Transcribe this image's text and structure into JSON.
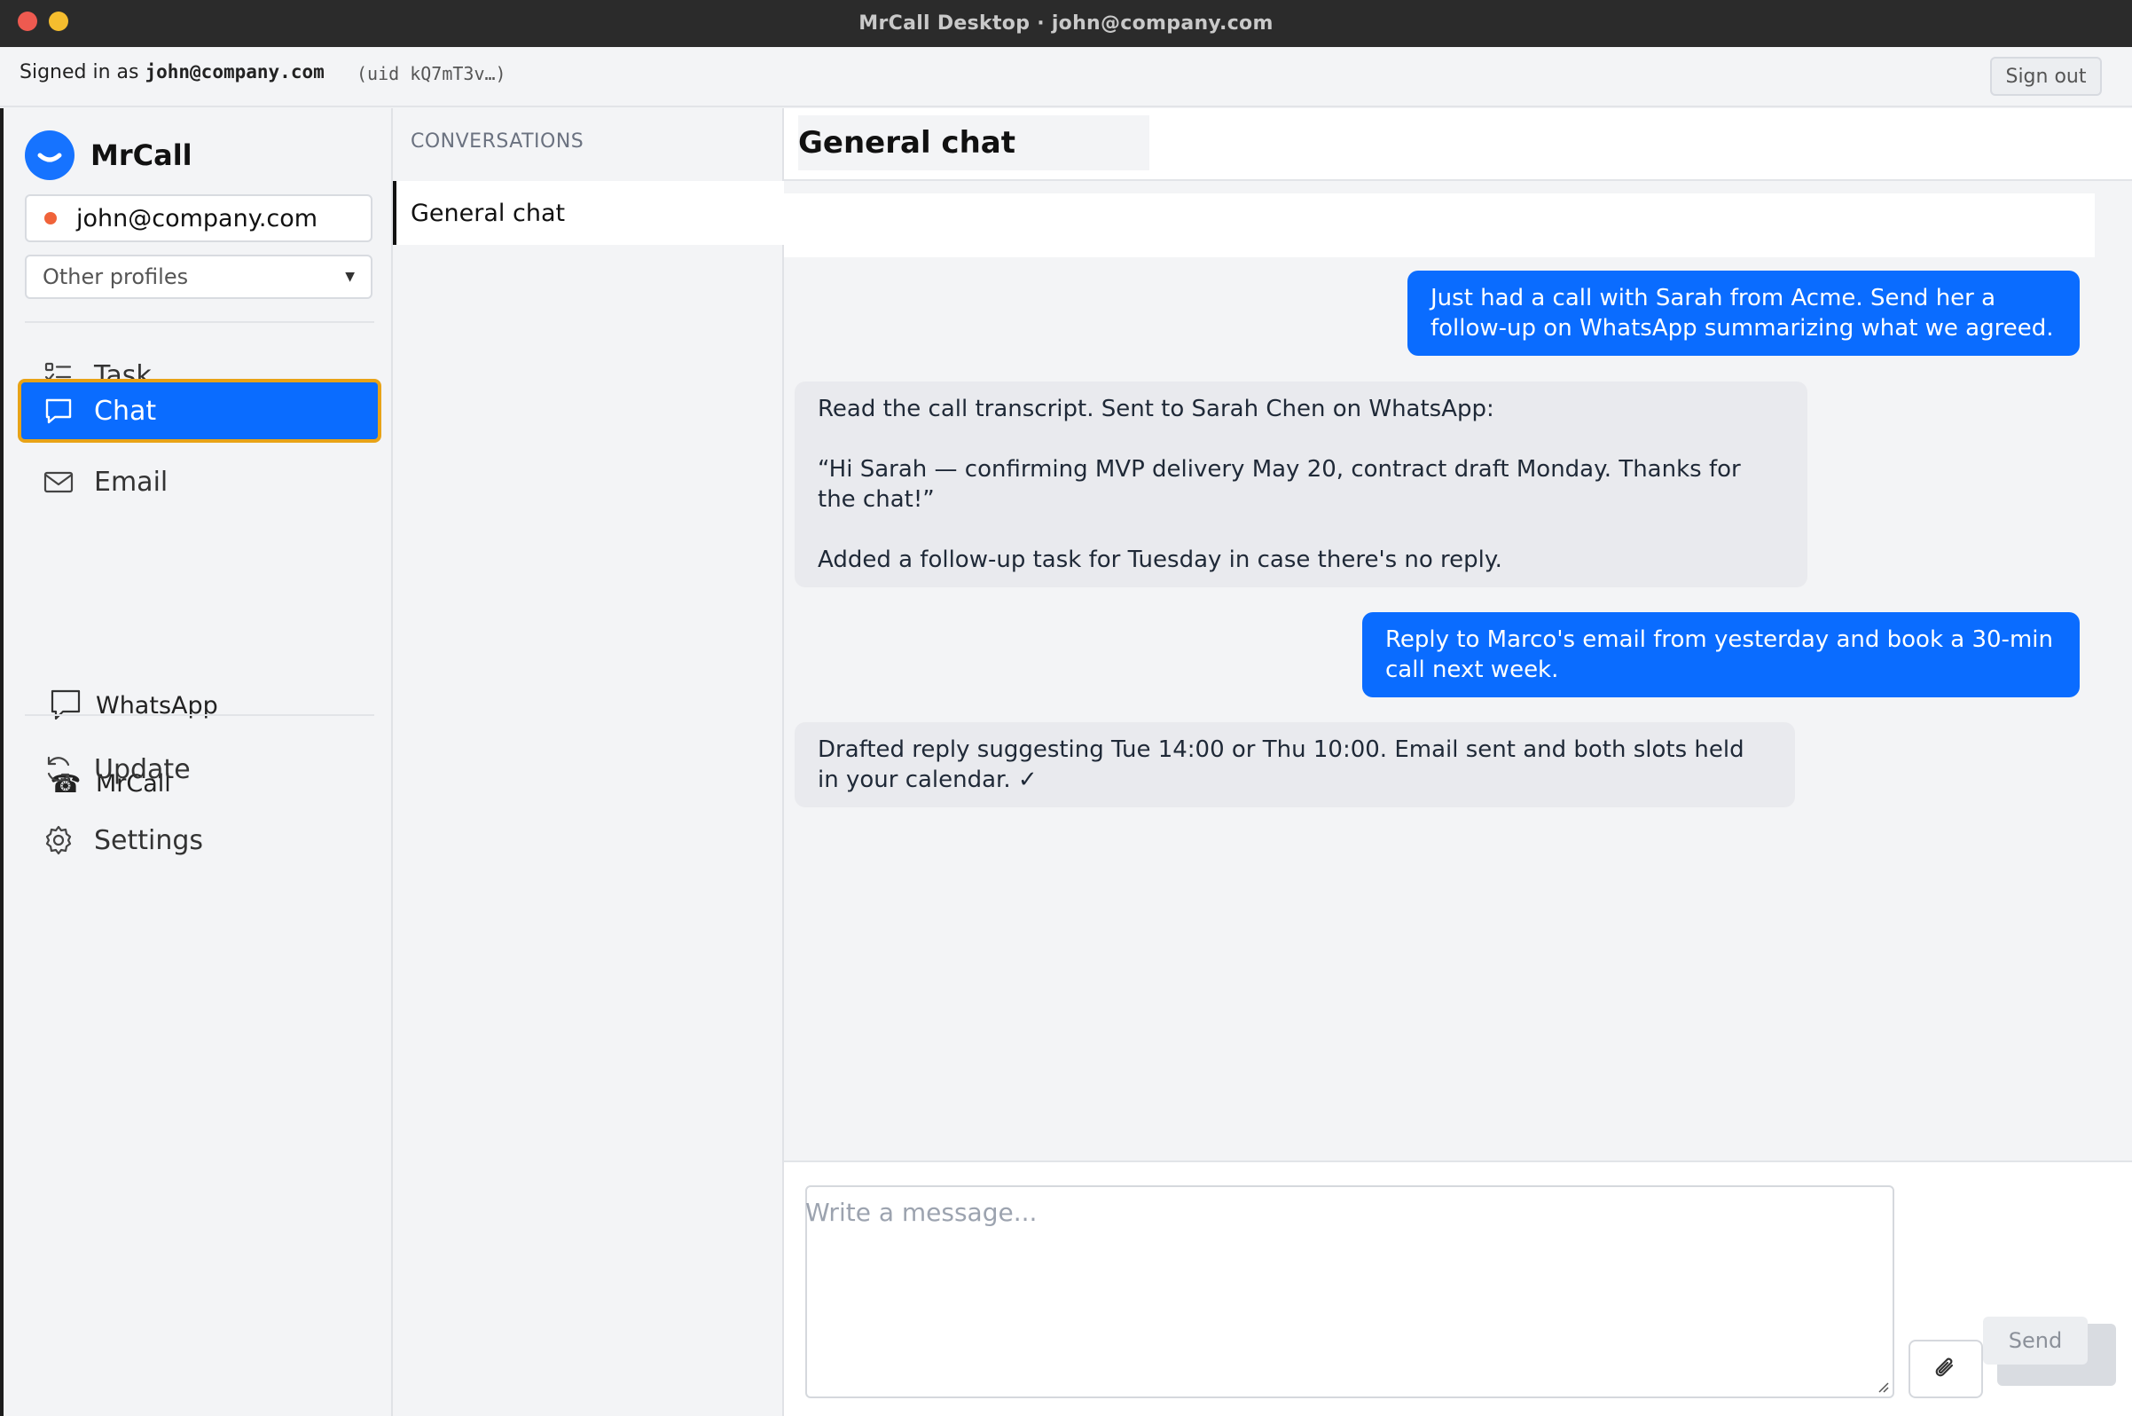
{
  "window": {
    "title": "MrCall Desktop  ·  john@company.com"
  },
  "signbar": {
    "prefix": "Signed in as ",
    "email": "john@company.com",
    "uid": "(uid kQ7mT3v…)",
    "signout_label": "Sign out"
  },
  "sidebar": {
    "brand": "MrCall",
    "profile": "john@company.com",
    "other_profiles": "Other profiles",
    "items": [
      {
        "label": "Task",
        "icon": "task-list-icon"
      },
      {
        "label": "Chat",
        "icon": "chat-bubble-icon",
        "active": true
      },
      {
        "label": "Email",
        "icon": "envelope-icon"
      },
      {
        "label": "WhatsApp",
        "icon": "whatsapp-bubble-icon"
      },
      {
        "label": "MrCall",
        "icon": "telephone-icon"
      },
      {
        "label": "Update",
        "icon": "refresh-icon"
      },
      {
        "label": "Settings",
        "icon": "gear-icon"
      }
    ]
  },
  "conversations": {
    "header": "CONVERSATIONS",
    "items": [
      {
        "label": "General chat",
        "selected": true
      }
    ]
  },
  "chat": {
    "title": "General chat",
    "messages": [
      {
        "role": "user",
        "lines": [
          "Just had a call with Sarah from Acme. Send her a follow-up on WhatsApp summarizing what we agreed."
        ]
      },
      {
        "role": "assistant",
        "paragraphs": [
          "Read the call transcript. Sent to Sarah Chen on WhatsApp:",
          "“Hi Sarah — confirming MVP delivery May 20, contract draft Monday. Thanks for the chat!”",
          "Added a follow-up task for Tuesday in case there's no reply."
        ]
      },
      {
        "role": "user",
        "lines": [
          "Reply to Marco's email from yesterday and book a 30-min call next week."
        ]
      },
      {
        "role": "assistant",
        "paragraphs": [
          "Drafted reply suggesting Tue 14:00 or Thu 10:00. Email sent and both slots held in your calendar. ✓"
        ]
      }
    ],
    "composer_placeholder": "Write a message...",
    "send_label": "Send"
  },
  "colors": {
    "accent": "#0a6cff",
    "focus_ring": "#e8a317",
    "status_dot": "#f0633a"
  }
}
